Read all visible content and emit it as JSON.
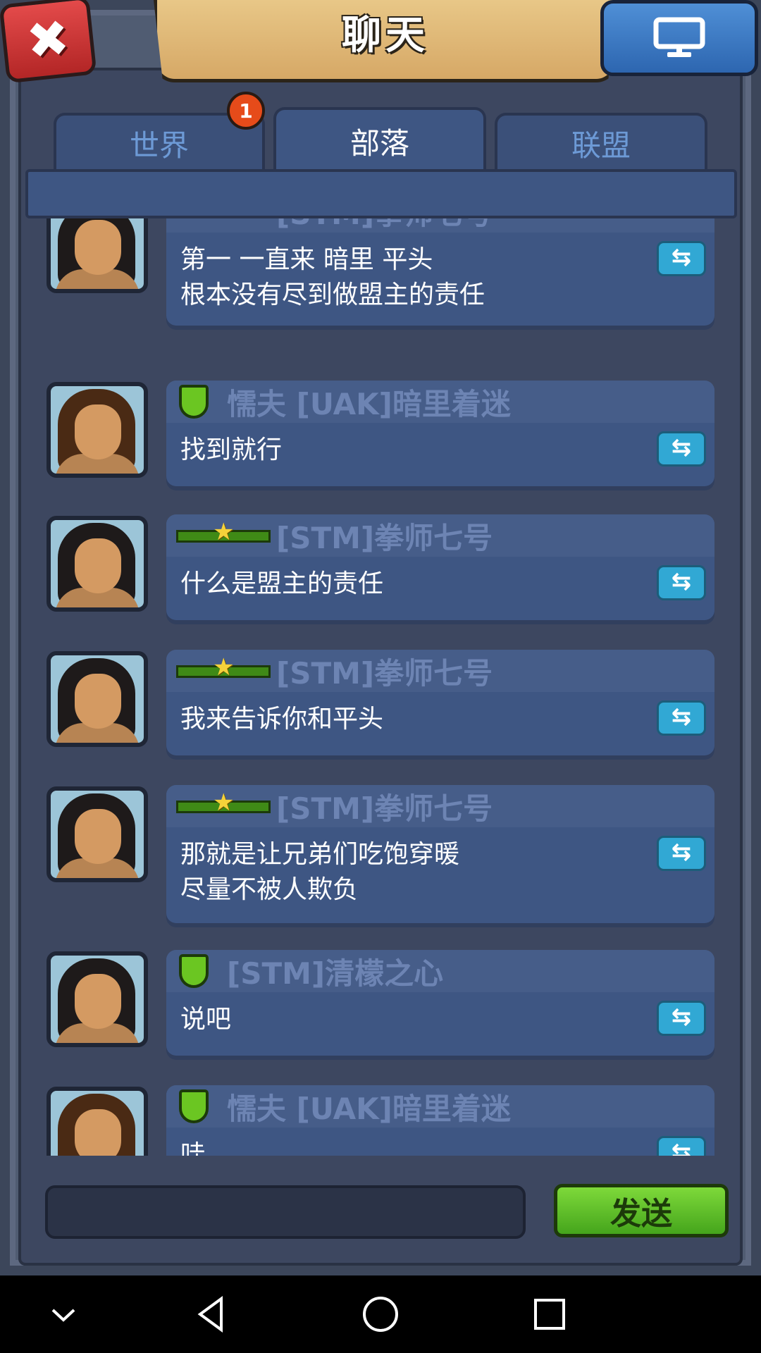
{
  "header": {
    "title": "聊天",
    "close_icon": "close-icon",
    "screen_icon": "monitor-icon"
  },
  "tabs": [
    {
      "label": "世界",
      "active": false
    },
    {
      "label": "部落",
      "active": true
    },
    {
      "label": "联盟",
      "active": false
    }
  ],
  "tab_badge": "1",
  "messages": [
    {
      "sender": "[STM]拳师七号",
      "rank": "star",
      "lines": [
        "第一 一直来 暗里 平头",
        "根本没有尽到做盟主的责任"
      ]
    },
    {
      "sender": "懦夫 [UAK]暗里着迷",
      "rank": "shield",
      "lines": [
        "找到就行"
      ]
    },
    {
      "sender": "[STM]拳师七号",
      "rank": "star",
      "lines": [
        "什么是盟主的责任"
      ]
    },
    {
      "sender": "[STM]拳师七号",
      "rank": "star",
      "lines": [
        "我来告诉你和平头"
      ]
    },
    {
      "sender": "[STM]拳师七号",
      "rank": "star",
      "lines": [
        "那就是让兄弟们吃饱穿暖",
        "尽量不被人欺负"
      ]
    },
    {
      "sender": "[STM]清檬之心",
      "rank": "shield",
      "lines": [
        "说吧"
      ]
    },
    {
      "sender": "懦夫 [UAK]暗里着迷",
      "rank": "shield",
      "lines": [
        "哇"
      ]
    }
  ],
  "reply_symbol": "⇆",
  "input": {
    "value": "",
    "placeholder": ""
  },
  "send_label": "发送",
  "nav": [
    "chevron-down-icon",
    "back-icon",
    "home-icon",
    "recents-icon"
  ]
}
